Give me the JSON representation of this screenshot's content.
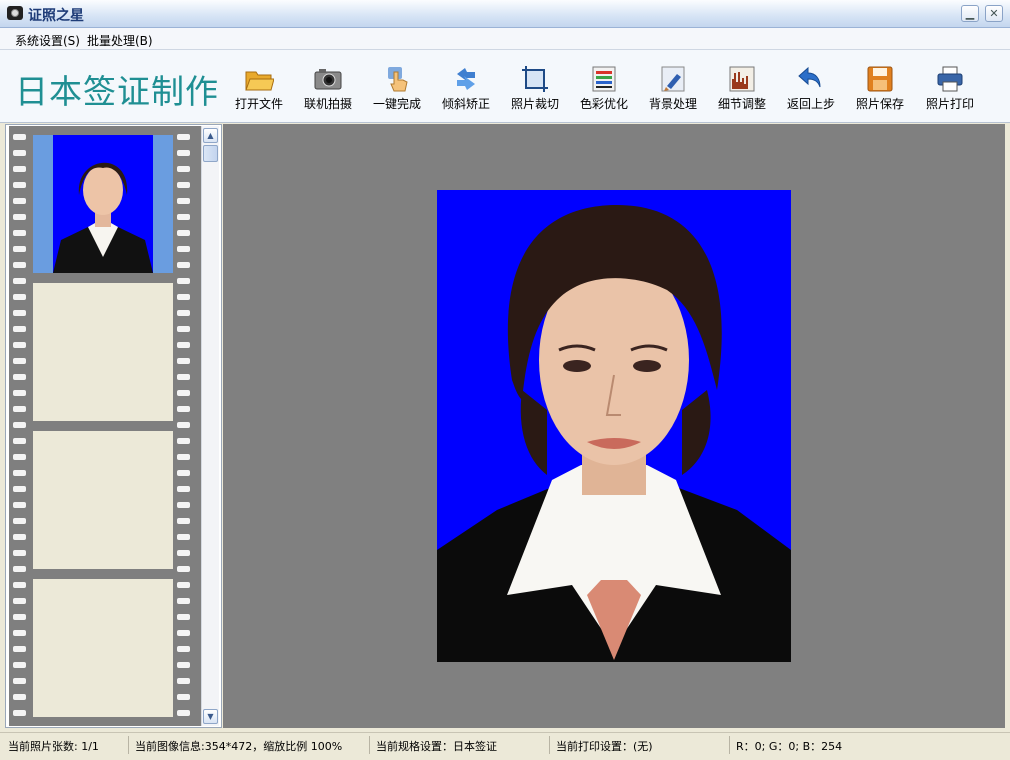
{
  "window": {
    "title": "证照之星"
  },
  "menu": {
    "items": [
      "系统设置(S)",
      "批量处理(B)"
    ]
  },
  "toolbar": {
    "brand": "日本签证制作",
    "buttons": [
      {
        "label": "打开文件",
        "icon": "folder-open-icon"
      },
      {
        "label": "联机拍摄",
        "icon": "camera-icon"
      },
      {
        "label": "一键完成",
        "icon": "hand-pointer-icon"
      },
      {
        "label": "倾斜矫正",
        "icon": "rotate-correct-icon"
      },
      {
        "label": "照片裁切",
        "icon": "crop-icon"
      },
      {
        "label": "色彩优化",
        "icon": "color-palette-icon"
      },
      {
        "label": "背景处理",
        "icon": "background-brush-icon"
      },
      {
        "label": "细节调整",
        "icon": "histogram-icon"
      },
      {
        "label": "返回上步",
        "icon": "undo-icon"
      },
      {
        "label": "照片保存",
        "icon": "save-disk-icon"
      },
      {
        "label": "照片打印",
        "icon": "printer-icon"
      }
    ]
  },
  "colors": {
    "photo_background": "#0000ff",
    "canvas": "#808080",
    "brand": "#1f8f93"
  },
  "status": {
    "photo_count": "当前照片张数: 1/1",
    "image_info": "当前图像信息:354*472，缩放比例 100%",
    "spec": "当前规格设置：日本签证",
    "print": "当前打印设置：(无)",
    "rgb": "R：0; G：0; B：254"
  }
}
